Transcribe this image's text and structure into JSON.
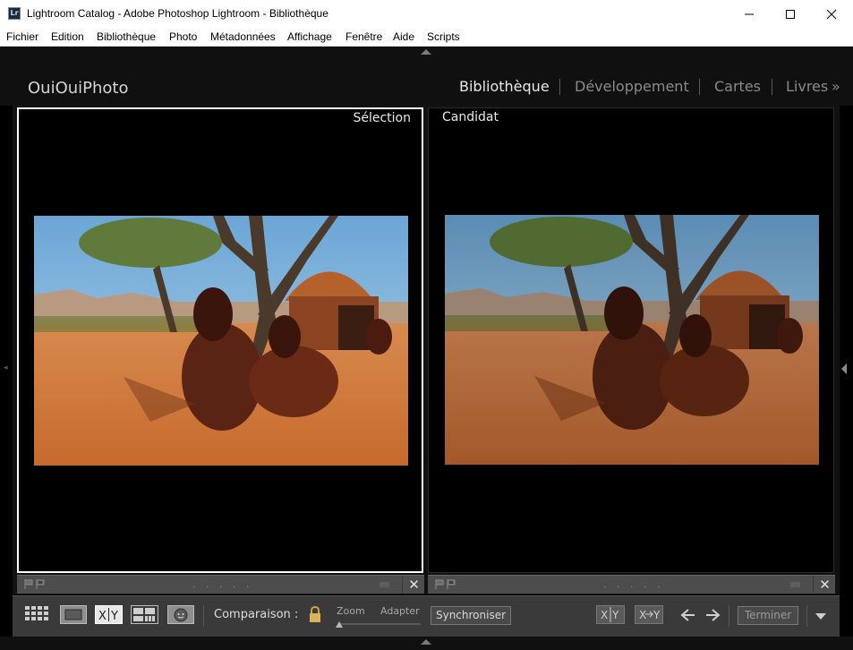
{
  "window": {
    "title": "Lightroom Catalog - Adobe Photoshop Lightroom - Bibliothèque",
    "app_icon_text": "Lr"
  },
  "menu": [
    "Fichier",
    "Edition",
    "Bibliothèque",
    "Photo",
    "Métadonnées",
    "Affichage",
    "Fenêtre",
    "Aide",
    "Scripts"
  ],
  "identity_plate": "OuiOuiPhoto",
  "modules": {
    "library": "Bibliothèque",
    "develop": "Développement",
    "map": "Cartes",
    "book": "Livres",
    "more": "»",
    "active": "library"
  },
  "compare": {
    "select_label": "Sélection",
    "candidate_label": "Candidat",
    "footer_dots": ". . . . .",
    "close_glyph": "✕"
  },
  "toolbar": {
    "compare_label": "Comparaison :",
    "zoom_label": "Zoom",
    "fit_label": "Adapter",
    "sync_label": "Synchroniser",
    "finish_label": "Terminer",
    "xy_label": "X|Y"
  },
  "colors": {
    "selection_border": "#ffffff",
    "toolbar_bg": "#3a3a3a",
    "footer_bg": "#4d4d4d"
  }
}
